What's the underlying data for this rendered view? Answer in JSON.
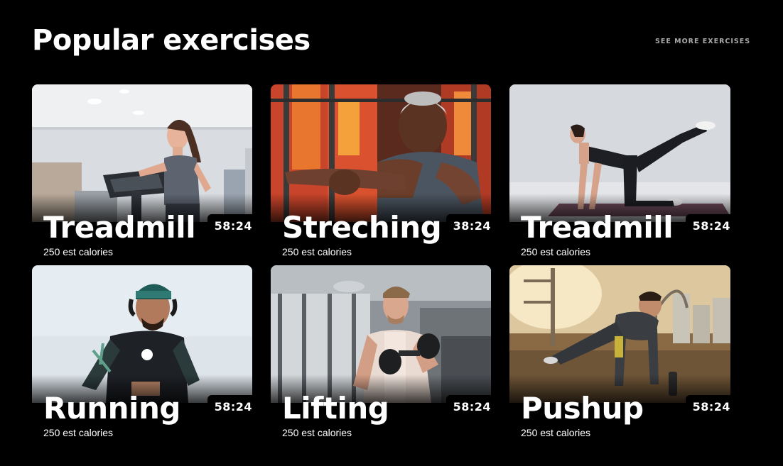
{
  "header": {
    "title": "Popular exercises",
    "see_more": "SEE MORE EXERCISES"
  },
  "colors": {
    "background": "#000000",
    "text": "#ffffff",
    "muted": "#a9a9a9"
  },
  "exercises": [
    {
      "name": "Treadmill",
      "time": "58:24",
      "calories": "250 est calories",
      "image": "woman-on-treadmill-photo"
    },
    {
      "name": "Streching",
      "time": "38:24",
      "calories": "250 est calories",
      "image": "man-stretching-arm-photo"
    },
    {
      "name": "Treadmill",
      "time": "58:24",
      "calories": "250 est calories",
      "image": "woman-yoga-leg-raise-photo"
    },
    {
      "name": "Running",
      "time": "58:24",
      "calories": "250 est calories",
      "image": "man-running-headphones-photo"
    },
    {
      "name": "Lifting",
      "time": "58:24",
      "calories": "250 est calories",
      "image": "man-dumbbell-curl-photo"
    },
    {
      "name": "Pushup",
      "time": "58:24",
      "calories": "250 est calories",
      "image": "man-pushup-outdoors-photo"
    }
  ]
}
